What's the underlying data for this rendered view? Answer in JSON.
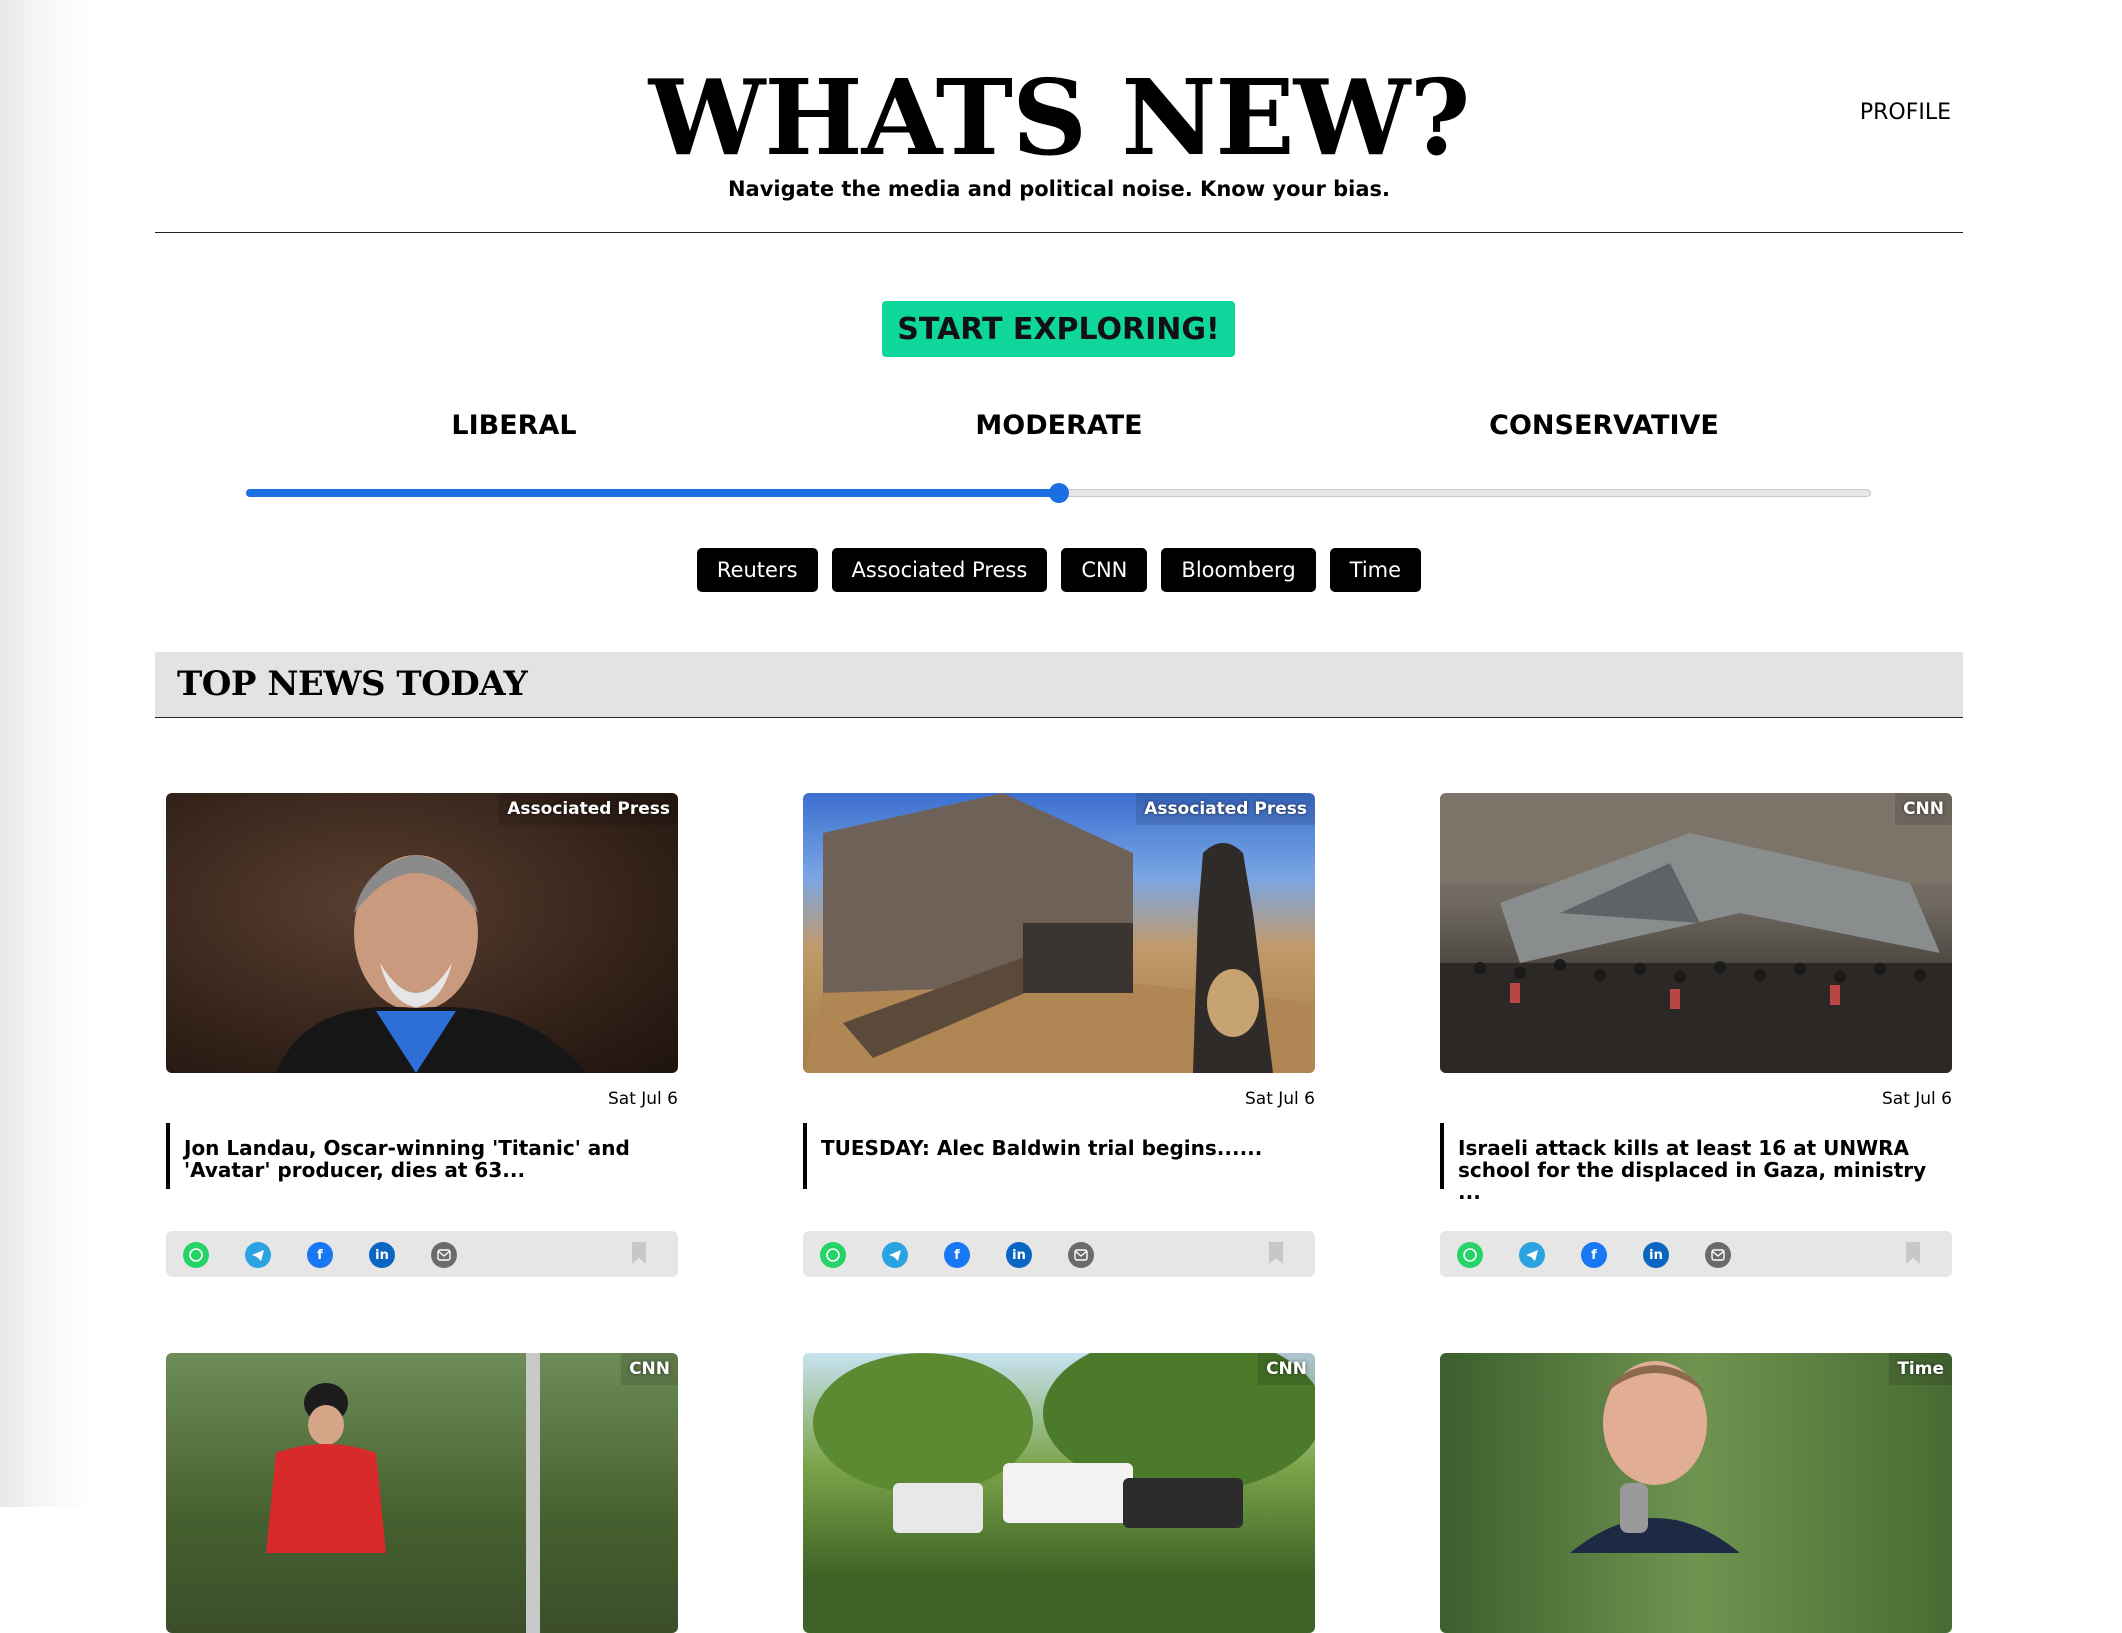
{
  "header": {
    "title": "WHATS NEW?",
    "tagline": "Navigate the media and political noise. Know your bias.",
    "profile_label": "PROFILE"
  },
  "cta": {
    "label": "START EXPLORING!"
  },
  "bias": {
    "labels": [
      "LIBERAL",
      "MODERATE",
      "CONSERVATIVE"
    ],
    "slider_value": 0.5
  },
  "sources": [
    "Reuters",
    "Associated Press",
    "CNN",
    "Bloomberg",
    "Time"
  ],
  "section": {
    "title": "TOP NEWS TODAY"
  },
  "colors": {
    "accent_green": "#0fd69b",
    "slider_blue": "#1b6fe3",
    "whatsapp": "#25d366",
    "telegram": "#2aa3e0",
    "facebook": "#1877f2",
    "linkedin": "#0a66c2",
    "email": "#6b6b6b"
  },
  "articles": [
    {
      "source": "Associated Press",
      "date": "Sat Jul 6",
      "headline": "Jon Landau, Oscar-winning 'Titanic' and 'Avatar' producer, dies at 63..."
    },
    {
      "source": "Associated Press",
      "date": "Sat Jul 6",
      "headline": "TUESDAY: Alec Baldwin trial begins......"
    },
    {
      "source": "CNN",
      "date": "Sat Jul 6",
      "headline": "Israeli attack kills at least 16 at UNWRA school for the displaced in Gaza, ministry ..."
    },
    {
      "source": "CNN"
    },
    {
      "source": "CNN"
    },
    {
      "source": "Time"
    }
  ],
  "share_icons": [
    "whatsapp-icon",
    "telegram-icon",
    "facebook-icon",
    "linkedin-icon",
    "email-icon"
  ],
  "share_glyphs": {
    "facebook": "f",
    "linkedin": "in"
  }
}
